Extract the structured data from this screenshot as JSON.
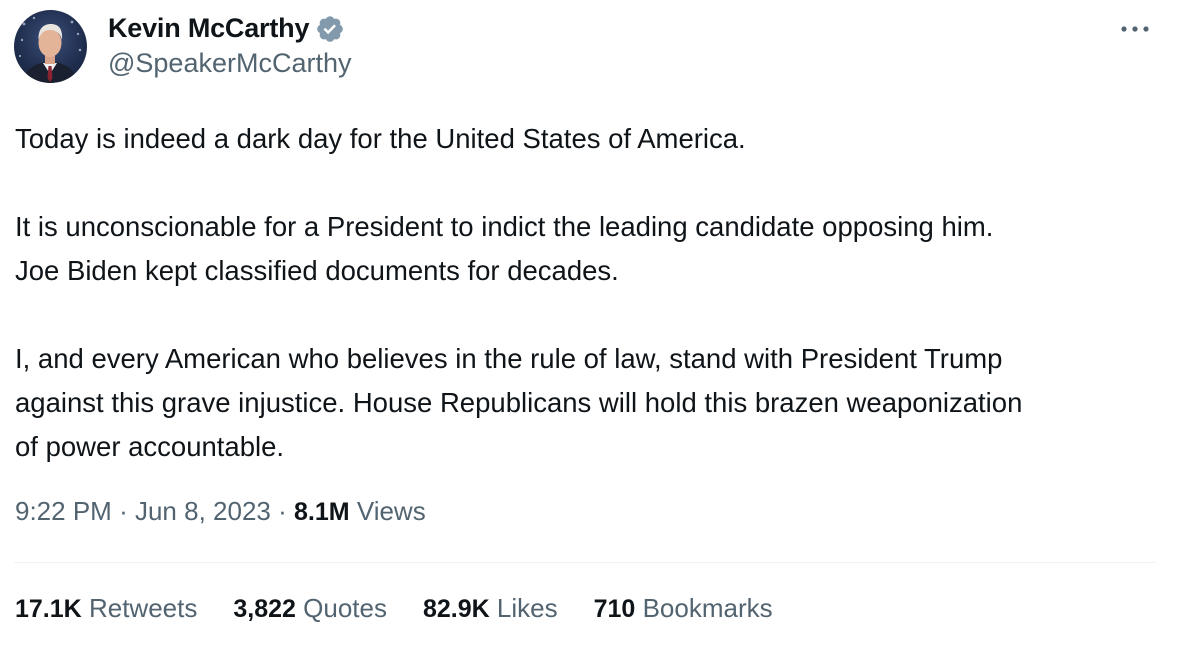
{
  "author": {
    "display_name": "Kevin McCarthy",
    "handle": "@SpeakerMcCarthy",
    "verified_icon": "verified-badge",
    "verified_color": "#829aab"
  },
  "tweet": {
    "paragraphs": [
      [
        "Today is indeed a dark day for the United States of America."
      ],
      [
        "It is unconscionable for a President to indict the leading candidate opposing him.",
        "Joe Biden kept classified documents for decades."
      ],
      [
        "I, and every American who believes in the rule of law, stand with President Trump",
        "against this grave injustice. House Republicans will hold this brazen weaponization",
        "of power accountable."
      ]
    ]
  },
  "meta": {
    "time": "9:22 PM",
    "separator": "·",
    "date": "Jun 8, 2023",
    "views_count": "8.1M",
    "views_label": "Views"
  },
  "stats": [
    {
      "count": "17.1K",
      "label": "Retweets"
    },
    {
      "count": "3,822",
      "label": "Quotes"
    },
    {
      "count": "82.9K",
      "label": "Likes"
    },
    {
      "count": "710",
      "label": "Bookmarks"
    }
  ],
  "menu": {
    "icon": "more-horizontal-icon"
  },
  "colors": {
    "text_primary": "#0f1419",
    "text_secondary": "#536471",
    "divider": "#eff3f4"
  }
}
